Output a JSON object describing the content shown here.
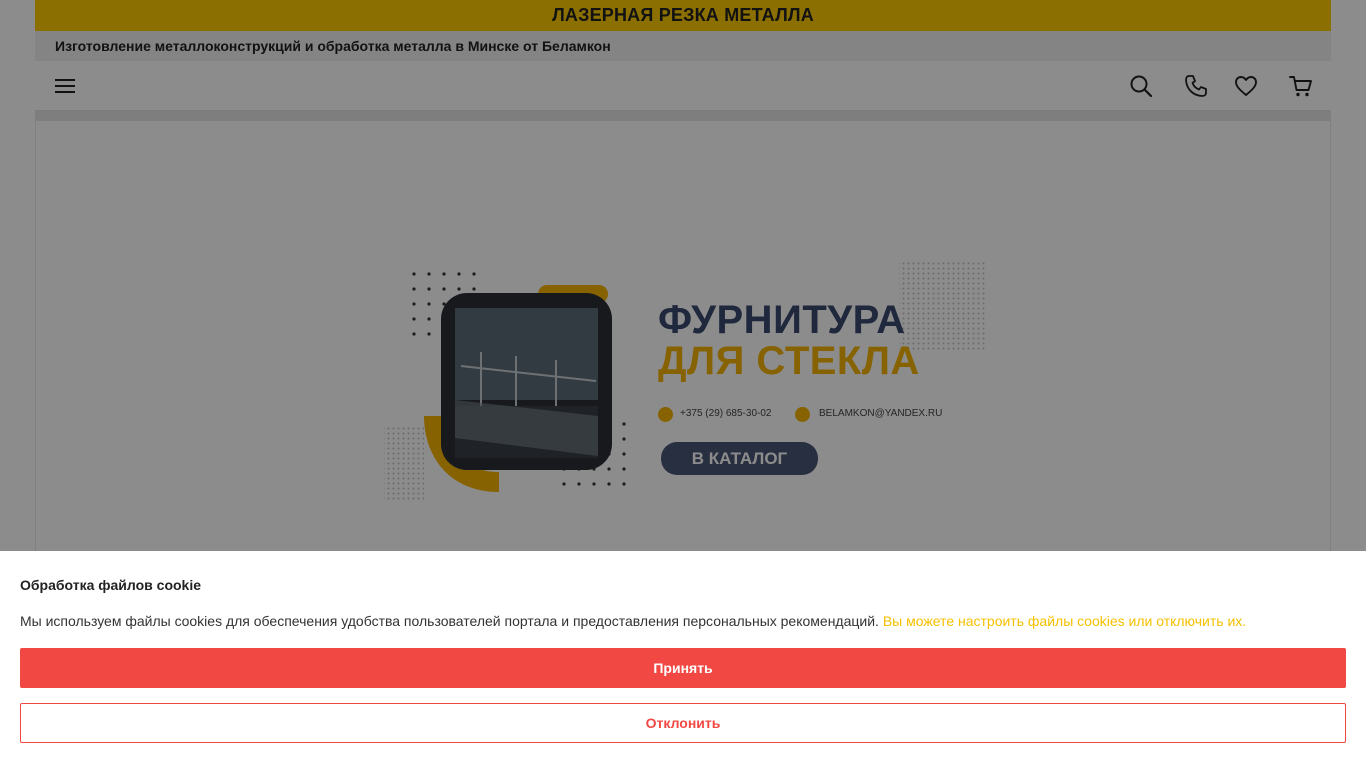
{
  "header": {
    "top_banner": "ЛАЗЕРНАЯ РЕЗКА МЕТАЛЛА",
    "tagline": "Изготовление металлоконструкций и обработка металла в Минске от Беламкон"
  },
  "nav": {
    "icons": [
      "menu-icon",
      "search-icon",
      "phone-icon",
      "heart-icon",
      "cart-icon"
    ]
  },
  "banner": {
    "title_line1": "ФУРНИТУРА",
    "title_line2": "ДЛЯ СТЕКЛА",
    "phone": "+375 (29) 685-30-02",
    "email": "BELAMKON@YANDEX.RU",
    "cta": "В КАТАЛОГ"
  },
  "cookie": {
    "title": "Обработка файлов cookie",
    "text": "Мы используем файлы cookies для обеспечения удобства пользователей портала и предоставления персональных рекомендаций.",
    "link": "Вы можете настроить файлы cookies или отключить их.",
    "accept": "Принять",
    "decline": "Отклонить"
  },
  "colors": {
    "brand_yellow": "#fecb00",
    "accept_red": "#f24843",
    "banner_navy": "#3a4a6d",
    "link_yellow": "#f6c000"
  }
}
